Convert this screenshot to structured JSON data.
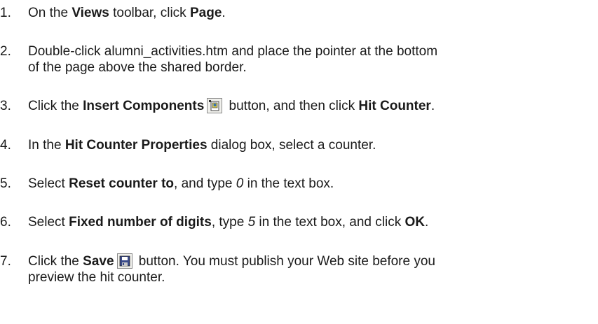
{
  "steps": [
    {
      "number": "1.",
      "parts": {
        "a": "On the ",
        "b": "Views",
        "c": " toolbar, click ",
        "d": "Page",
        "e": "."
      }
    },
    {
      "number": "2.",
      "line1": "Double-click alumni_activities.htm and place the pointer at the bottom",
      "line2": "of the page above the shared border."
    },
    {
      "number": "3.",
      "parts": {
        "a": "Click the ",
        "b": "Insert Components",
        "c": " button, and then click ",
        "d": "Hit Counter",
        "e": "."
      },
      "icon": "insert-components-icon"
    },
    {
      "number": "4.",
      "parts": {
        "a": "In the ",
        "b": "Hit Counter Properties",
        "c": " dialog box, select a counter."
      }
    },
    {
      "number": "5.",
      "parts": {
        "a": "Select ",
        "b": "Reset counter to",
        "c": ", and type ",
        "d": "0",
        "e": " in the text box."
      }
    },
    {
      "number": "6.",
      "parts": {
        "a": "Select ",
        "b": "Fixed number of digits",
        "c": ", type ",
        "d": "5",
        "e": " in the text box, and click ",
        "f": "OK",
        "g": "."
      }
    },
    {
      "number": "7.",
      "parts": {
        "a": "Click the ",
        "b": "Save",
        "c": " button. You must publish your Web site before you"
      },
      "line2": "preview the hit counter.",
      "icon": "save-icon"
    }
  ]
}
